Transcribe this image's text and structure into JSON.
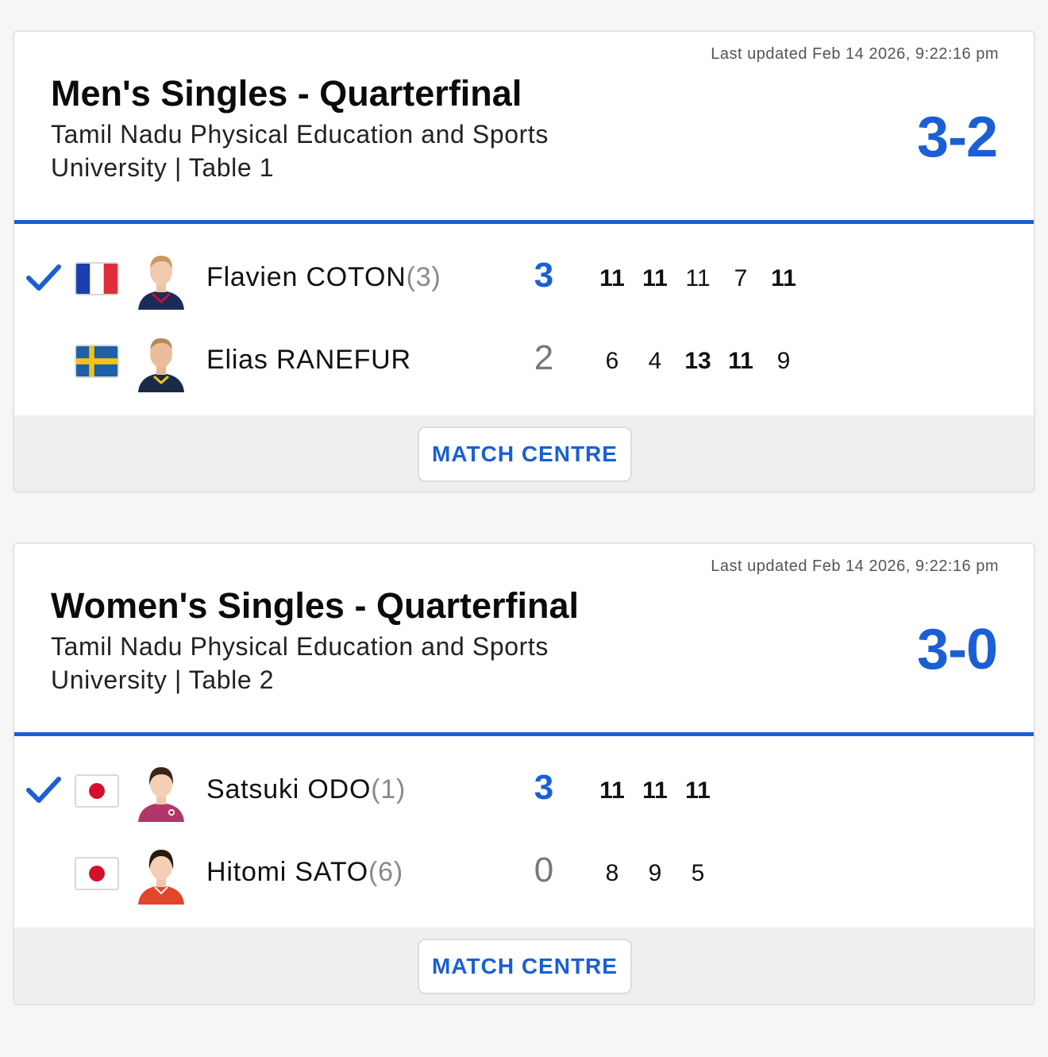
{
  "colors": {
    "accent": "#1a5fd6",
    "divider": "#1a5fd6",
    "footer_bg": "#efefef"
  },
  "matches": [
    {
      "updated": "Last updated Feb 14 2026, 9:22:16 pm",
      "title": "Men's Singles - Quarterfinal",
      "venue": "Tamil Nadu Physical Education and Sports University | Table 1",
      "score": "3-2",
      "button_label": "MATCH CENTRE",
      "players": [
        {
          "winner": true,
          "country": "France",
          "flag_icon": "france-flag-icon",
          "name": "Flavien COTON",
          "seed": "(3)",
          "sets": "3",
          "games": [
            {
              "value": "11",
              "bold": true
            },
            {
              "value": "11",
              "bold": true
            },
            {
              "value": "11",
              "bold": false
            },
            {
              "value": "7",
              "bold": false
            },
            {
              "value": "11",
              "bold": true
            }
          ]
        },
        {
          "winner": false,
          "country": "Sweden",
          "flag_icon": "sweden-flag-icon",
          "name": "Elias RANEFUR",
          "seed": "",
          "sets": "2",
          "games": [
            {
              "value": "6",
              "bold": false
            },
            {
              "value": "4",
              "bold": false
            },
            {
              "value": "13",
              "bold": true
            },
            {
              "value": "11",
              "bold": true
            },
            {
              "value": "9",
              "bold": false
            }
          ]
        }
      ]
    },
    {
      "updated": "Last updated Feb 14 2026, 9:22:16 pm",
      "title": "Women's Singles - Quarterfinal",
      "venue": "Tamil Nadu Physical Education and Sports University | Table 2",
      "score": "3-0",
      "button_label": "MATCH CENTRE",
      "players": [
        {
          "winner": true,
          "country": "Japan",
          "flag_icon": "japan-flag-icon",
          "name": "Satsuki ODO",
          "seed": "(1)",
          "sets": "3",
          "games": [
            {
              "value": "11",
              "bold": true
            },
            {
              "value": "11",
              "bold": true
            },
            {
              "value": "11",
              "bold": true
            }
          ]
        },
        {
          "winner": false,
          "country": "Japan",
          "flag_icon": "japan-flag-icon",
          "name": "Hitomi SATO",
          "seed": "(6)",
          "sets": "0",
          "games": [
            {
              "value": "8",
              "bold": false
            },
            {
              "value": "9",
              "bold": false
            },
            {
              "value": "5",
              "bold": false
            }
          ]
        }
      ]
    }
  ]
}
